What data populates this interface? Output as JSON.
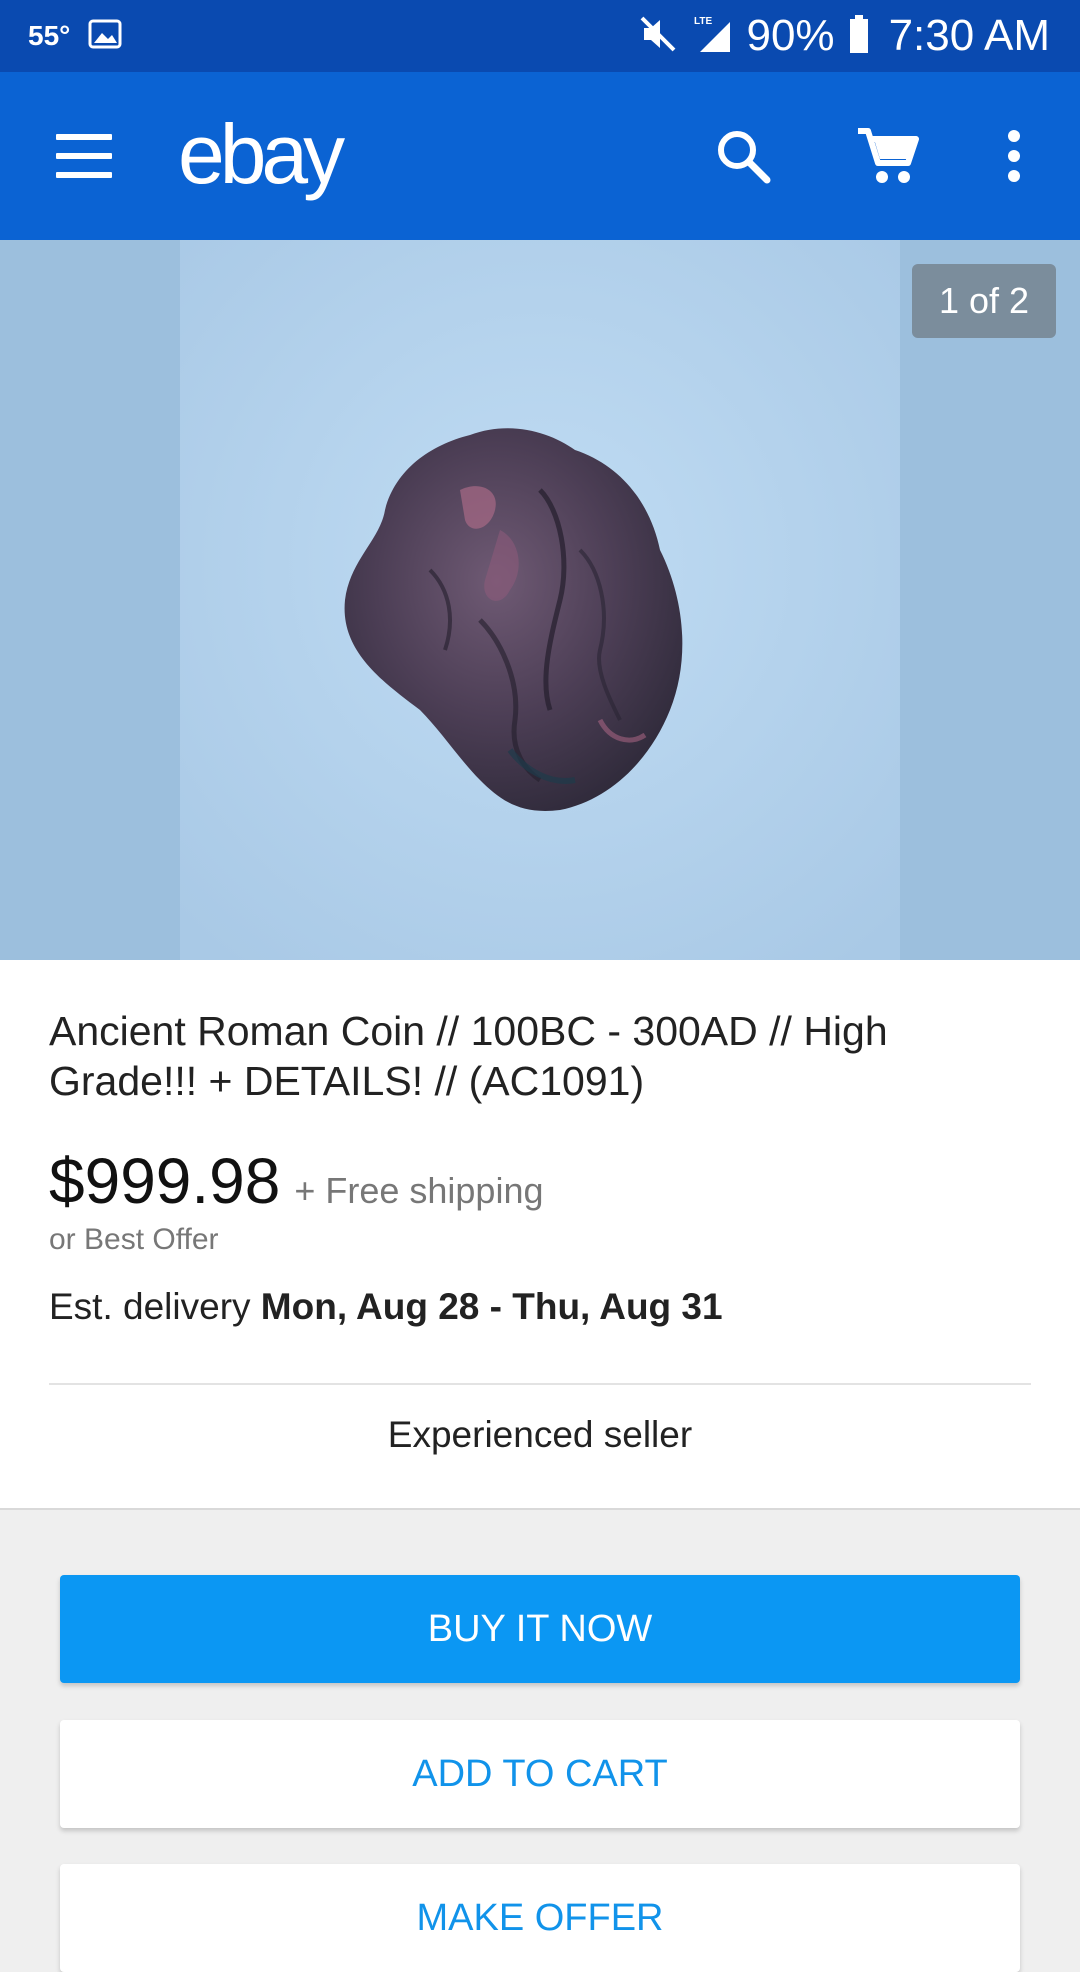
{
  "status_bar": {
    "temperature": "55°",
    "battery": "90%",
    "time": "7:30 AM",
    "icons": [
      "image-icon",
      "mute-icon",
      "lte-signal-icon",
      "battery-icon"
    ]
  },
  "app_bar": {
    "logo": "ebay",
    "icons": [
      "menu-icon",
      "search-icon",
      "cart-icon",
      "more-vert-icon"
    ]
  },
  "gallery": {
    "counter": "1 of 2"
  },
  "listing": {
    "title": "Ancient Roman Coin // 100BC - 300AD // High Grade!!! + DETAILS! // (AC1091)",
    "price": "$999.98",
    "shipping": "+ Free shipping",
    "best_offer": "or Best Offer",
    "delivery_label": "Est. delivery",
    "delivery_dates": "Mon, Aug 28 - Thu, Aug 31",
    "seller_badge": "Experienced seller"
  },
  "actions": {
    "buy_now": "BUY IT NOW",
    "add_to_cart": "ADD TO CART",
    "make_offer": "MAKE OFFER"
  },
  "colors": {
    "status_bar": "#0a4ab0",
    "app_bar": "#0b63d3",
    "buy_button": "#0b97f3",
    "link_blue": "#1193ea"
  }
}
